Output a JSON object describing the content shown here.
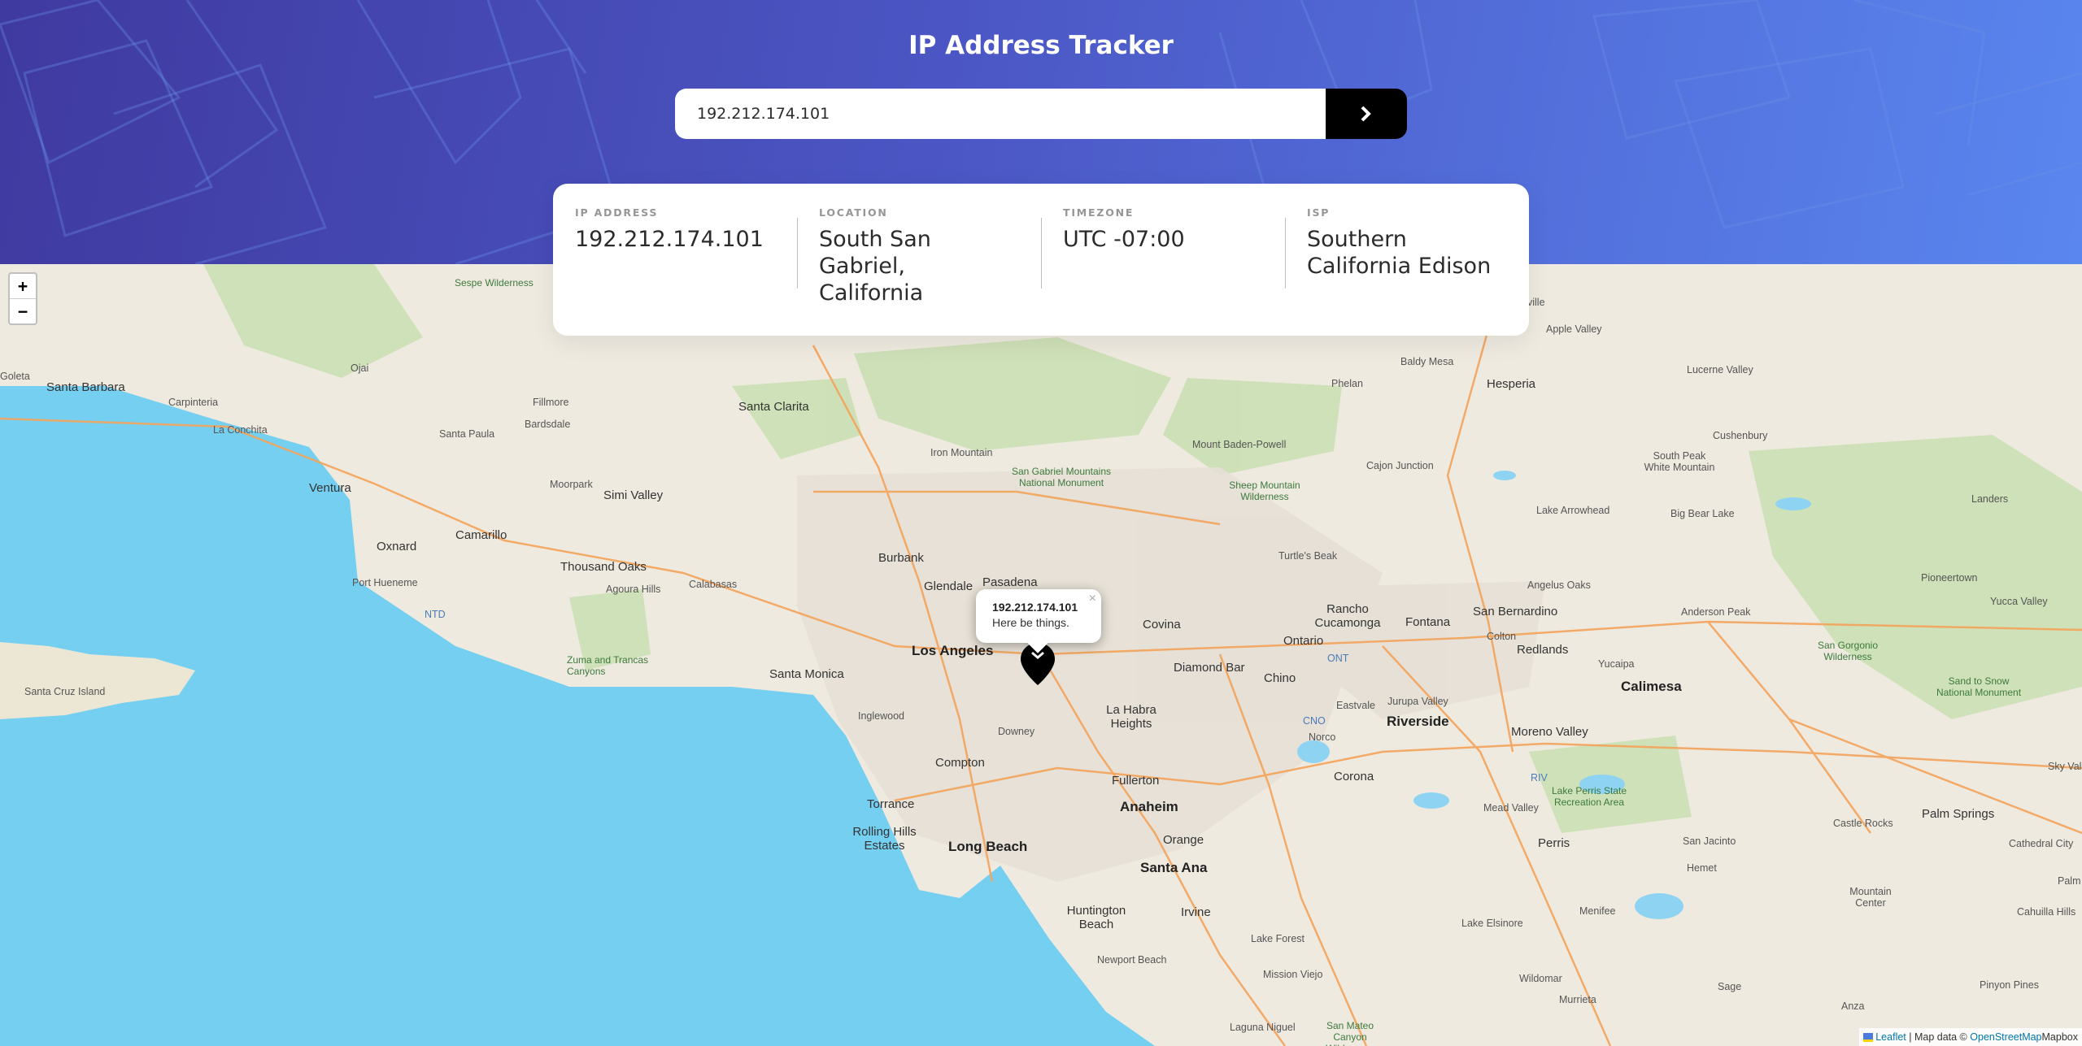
{
  "header": {
    "title": "IP Address Tracker"
  },
  "search": {
    "value": "192.212.174.101",
    "button_icon": "chevron-right-icon"
  },
  "info": [
    {
      "label": "IP ADDRESS",
      "value": "192.212.174.101"
    },
    {
      "label": "LOCATION",
      "value": "South San Gabriel, California"
    },
    {
      "label": "TIMEZONE",
      "value": "UTC -07:00"
    },
    {
      "label": "ISP",
      "value": "Southern California Edison"
    }
  ],
  "map": {
    "zoom_in": "+",
    "zoom_out": "−",
    "popup": {
      "title": "192.212.174.101",
      "text": "Here be things.",
      "close": "×"
    },
    "attribution": {
      "leaflet": "Leaflet",
      "separator": "| Map data ©",
      "osm": "OpenStreetMap",
      "mapbox": "Mapbox"
    },
    "places": {
      "los_angeles": "Los Angeles",
      "santa_monica": "Santa Monica",
      "pasadena": "Pasadena",
      "glendale": "Glendale",
      "burbank": "Burbank",
      "santa_clarita": "Santa Clarita",
      "oxnard": "Oxnard",
      "ventura": "Ventura",
      "camarillo": "Camarillo",
      "thousand_oaks": "Thousand Oaks",
      "simi_valley": "Simi Valley",
      "santa_barbara": "Santa Barbara",
      "carpinteria": "Carpinteria",
      "la_conchita": "La Conchita",
      "goleta": "Goleta",
      "santa_paula": "Santa Paula",
      "fillmore": "Fillmore",
      "moorpark": "Moorpark",
      "ojai": "Ojai",
      "bardsdale": "Bardsdale",
      "port_hueneme": "Port Hueneme",
      "santa_cruz_island": "Santa Cruz Island",
      "agoura_hills": "Agoura Hills",
      "calabasas": "Calabasas",
      "zuma": "Zuma and Trancas Canyons",
      "inglewood": "Inglewood",
      "compton": "Compton",
      "torrance": "Torrance",
      "rolling_hills": "Rolling Hills Estates",
      "long_beach": "Long Beach",
      "downey": "Downey",
      "la_habra": "La Habra Heights",
      "fullerton": "Fullerton",
      "anaheim": "Anaheim",
      "orange": "Orange",
      "santa_ana": "Santa Ana",
      "huntington": "Huntington Beach",
      "irvine": "Irvine",
      "newport": "Newport Beach",
      "lake_forest": "Lake Forest",
      "mission_viejo": "Mission Viejo",
      "laguna_niguel": "Laguna Niguel",
      "covina": "Covina",
      "diamond_bar": "Diamond Bar",
      "chino": "Chino",
      "ontario": "Ontario",
      "rancho": "Rancho Cucamonga",
      "fontana": "Fontana",
      "san_bernardino": "San Bernardino",
      "colton": "Colton",
      "redlands": "Redlands",
      "yucaipa": "Yucaipa",
      "calimesa": "Calimesa",
      "riverside": "Riverside",
      "moreno_valley": "Moreno Valley",
      "corona": "Corona",
      "norco": "Norco",
      "eastvale": "Eastvale",
      "jurupa": "Jurupa Valley",
      "mead_valley": "Mead Valley",
      "perris": "Perris",
      "lake_elsinore": "Lake Elsinore",
      "menifee": "Menifee",
      "wildomar": "Wildomar",
      "murrieta": "Murrieta",
      "hemet": "Hemet",
      "san_jacinto": "San Jacinto",
      "sage": "Sage",
      "anza": "Anza",
      "palm_springs": "Palm Springs",
      "palm_desert": "Palm Deser",
      "cathedral_city": "Cathedral City",
      "cahuilla": "Cahuilla Hills",
      "pinyon_pines": "Pinyon Pines",
      "mountain_center": "Mountain Center",
      "castle_rocks": "Castle Rocks",
      "hesperia": "Hesperia",
      "phelan": "Phelan",
      "baldy_mesa": "Baldy Mesa",
      "apple_valley": "Apple Valley",
      "lucerne_valley": "Lucerne Valley",
      "cushenbury": "Cushenbury",
      "south_peak": "South Peak White Mountain",
      "landers": "Landers",
      "lake_arrowhead": "Lake Arrowhead",
      "big_bear": "Big Bear Lake",
      "pioneertown": "Pioneertown",
      "yucca_valley": "Yucca Valley",
      "sky_valley": "Sky Val",
      "cajon": "Cajon Junction",
      "mount_baden": "Mount Baden-Powell",
      "iron_mountain": "Iron Mountain",
      "turtles_beak": "Turtle's Beak",
      "angelus_oaks": "Angelus Oaks",
      "anderson_peak": "Anderson Peak",
      "sg_mountains": "San Gabriel Mountains National Monument",
      "sheep_mountain": "Sheep Mountain Wilderness",
      "sespe": "Sespe Wilderness",
      "san_gorgonio": "San Gorgonio Wilderness",
      "sand_to_snow": "Sand to Snow National Monument",
      "lake_perris": "Lake Perris State Recreation Area",
      "san_mateo": "San Mateo Canyon Wilderness",
      "ville": "ville",
      "ntd": "NTD",
      "ont": "ONT",
      "cno": "CNO",
      "riv": "RIV"
    }
  }
}
